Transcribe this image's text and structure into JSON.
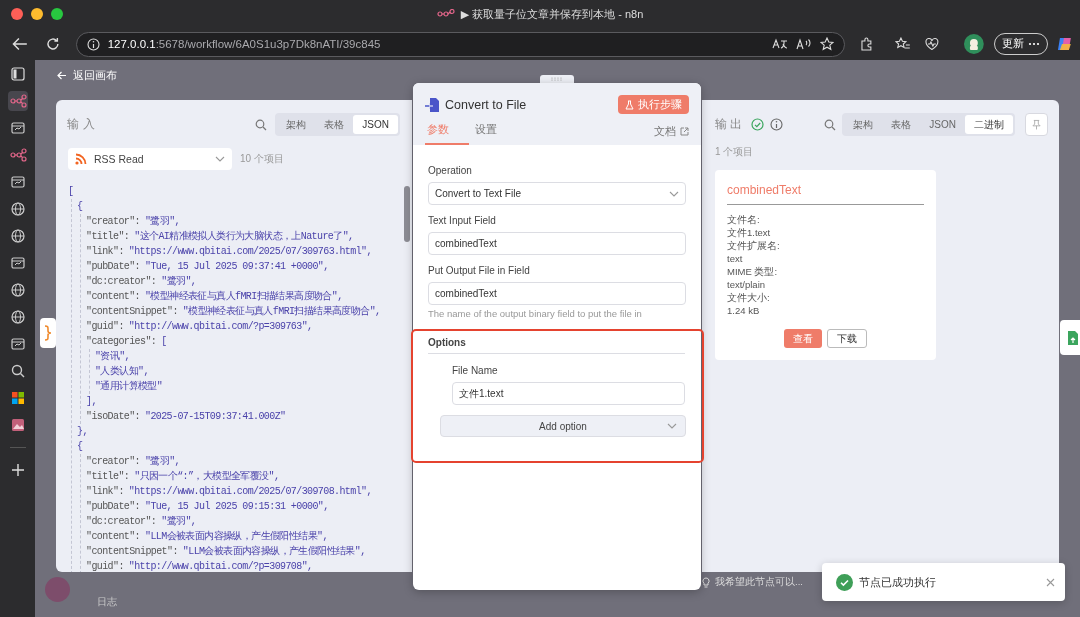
{
  "window": {
    "title": "▶ 获取量子位文章并保存到本地 - n8n"
  },
  "address_bar": {
    "host": "127.0.0.1",
    "path": ":5678/workflow/6A0S1u3p7Dk8nATI/39c845"
  },
  "update_button": "更新",
  "back_link": "返回画布",
  "input_panel": {
    "title": "输入",
    "tabs": [
      {
        "label": "架构",
        "selected": false
      },
      {
        "label": "表格",
        "selected": false
      },
      {
        "label": "JSON",
        "selected": true
      }
    ],
    "source": "RSS Read",
    "item_count": "10 个项目",
    "json": {
      "open": "[",
      "children": [
        {
          "open": "{",
          "close": "},",
          "children": [
            {
              "key": "\"creator\":",
              "value": "\"鹭羽\","
            },
            {
              "key": "\"title\":",
              "value": "\"这个AI精准模拟人类行为大脑状态，上Nature了\","
            },
            {
              "key": "\"link\":",
              "value": "\"https://www.qbitai.com/2025/07/309763.html\","
            },
            {
              "key": "\"pubDate\":",
              "value": "\"Tue, 15 Jul 2025 09:37:41 +0000\","
            },
            {
              "key": "\"dc:creator\":",
              "value": "\"鹭羽\","
            },
            {
              "key": "\"content\":",
              "value": "\"模型神经表征与真人fMRI扫描结果高度吻合\","
            },
            {
              "key": "\"contentSnippet\":",
              "value": "\"模型神经表征与真人fMRI扫描结果高度吻合\","
            },
            {
              "key": "\"guid\":",
              "value": "\"http://www.qbitai.com/?p=309763\","
            },
            {
              "key": "\"categories\":",
              "open": "[",
              "close": "],",
              "children": [
                {
                  "value": "\"资讯\","
                },
                {
                  "value": "\"人类认知\","
                },
                {
                  "value": "\"通用计算模型\""
                }
              ]
            },
            {
              "key": "\"isoDate\":",
              "value": "\"2025-07-15T09:37:41.000Z\""
            }
          ]
        },
        {
          "open": "{",
          "children": [
            {
              "key": "\"creator\":",
              "value": "\"鹭羽\","
            },
            {
              "key": "\"title\":",
              "value": "\"只因一个“:”，大模型全军覆没\","
            },
            {
              "key": "\"link\":",
              "value": "\"https://www.qbitai.com/2025/07/309708.html\","
            },
            {
              "key": "\"pubDate\":",
              "value": "\"Tue, 15 Jul 2025 09:15:31 +0000\","
            },
            {
              "key": "\"dc:creator\":",
              "value": "\"鹭羽\","
            },
            {
              "key": "\"content\":",
              "value": "\"LLM会被表面内容操纵，产生假阳性结果\","
            },
            {
              "key": "\"contentSnippet\":",
              "value": "\"LLM会被表面内容操纵，产生假阳性结果\","
            },
            {
              "key": "\"guid\":",
              "value": "\"http://www.qbitai.com/?p=309708\","
            }
          ]
        }
      ]
    }
  },
  "node_panel": {
    "title": "Convert to File",
    "run_button": "执行步骤",
    "tabs": [
      {
        "label": "参数",
        "selected": true
      },
      {
        "label": "设置",
        "selected": false
      }
    ],
    "docs_link": "文档",
    "fields": [
      {
        "kind": "select",
        "label": "Operation",
        "value": "Convert to Text File"
      },
      {
        "kind": "input",
        "label": "Text Input Field",
        "value": "combinedText"
      },
      {
        "kind": "input",
        "label": "Put Output File in Field",
        "value": "combinedText",
        "hint": "The name of the output binary field to put the file in"
      }
    ],
    "options": {
      "title": "Options",
      "fields": [
        {
          "kind": "input",
          "label": "File Name",
          "value": "文件1.text"
        }
      ],
      "add_button": "Add option"
    }
  },
  "output_panel": {
    "title": "输出",
    "tabs": [
      {
        "label": "架构",
        "selected": false
      },
      {
        "label": "表格",
        "selected": false
      },
      {
        "label": "JSON",
        "selected": false
      },
      {
        "label": "二进制",
        "selected": true
      }
    ],
    "item_count": "1 个项目",
    "file": {
      "name": "combinedText",
      "details": [
        {
          "label": "文件名:",
          "value": "文件1.text"
        },
        {
          "label": "文件扩展名:",
          "value": "text"
        },
        {
          "label": "MIME 类型:",
          "value": "text/plain"
        },
        {
          "label": "文件大小:",
          "value": "1.24 kB"
        }
      ],
      "view_button": "查看",
      "download_button": "下载"
    }
  },
  "log_label": "日志",
  "hint": "我希望此节点可以...",
  "toast": {
    "message": "节点已成功执行"
  }
}
